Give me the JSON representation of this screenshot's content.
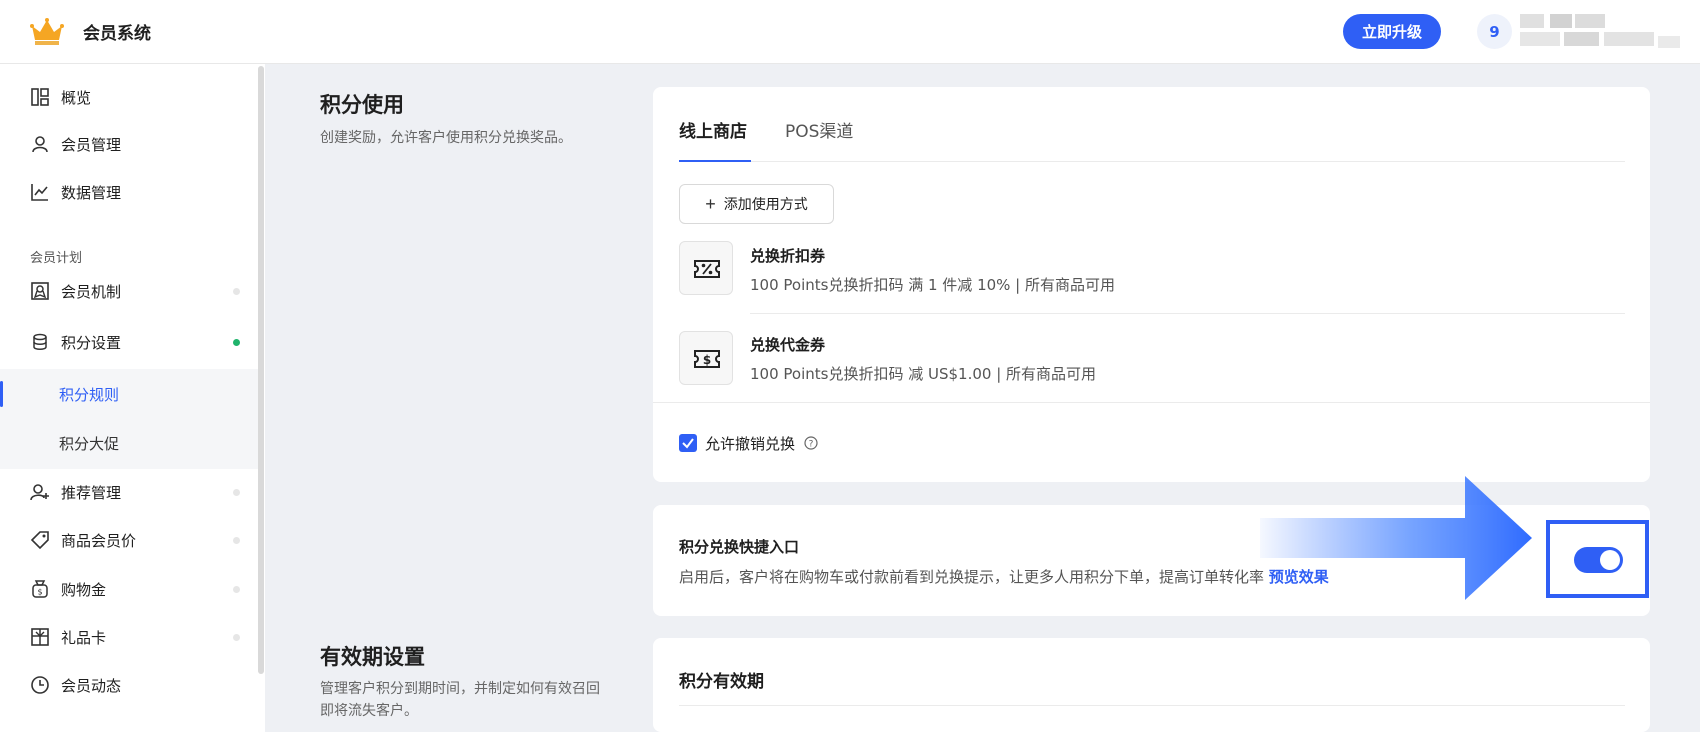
{
  "header": {
    "brand_title": "会员系统",
    "upgrade_label": "立即升级",
    "avatar_initial": "9"
  },
  "sidebar": {
    "items_top": [
      {
        "label": "概览",
        "icon": "dashboard-icon"
      },
      {
        "label": "会员管理",
        "icon": "user-icon"
      },
      {
        "label": "数据管理",
        "icon": "chart-icon"
      }
    ],
    "section_label": "会员计划",
    "items_plan": [
      {
        "label": "会员机制",
        "icon": "badge-icon"
      },
      {
        "label": "积分设置",
        "icon": "database-icon"
      }
    ],
    "sub_items": [
      {
        "label": "积分规则"
      },
      {
        "label": "积分大促"
      }
    ],
    "items_bottom": [
      {
        "label": "推荐管理",
        "icon": "user-add-icon"
      },
      {
        "label": "商品会员价",
        "icon": "tag-icon"
      },
      {
        "label": "购物金",
        "icon": "money-bag-icon"
      },
      {
        "label": "礼品卡",
        "icon": "gift-card-icon"
      },
      {
        "label": "会员动态",
        "icon": "clock-icon"
      }
    ],
    "active_dot_color": "#1fb36b"
  },
  "points_usage": {
    "title": "积分使用",
    "desc": "创建奖励，允许客户使用积分兑换奖品。",
    "tabs": [
      {
        "label": "线上商店"
      },
      {
        "label": "POS渠道"
      }
    ],
    "add_label": "添加使用方式",
    "coupons": [
      {
        "title": "兑换折扣券",
        "desc": "100 Points兑换折扣码 满 1 件减 10% | 所有商品可用",
        "icon": "percent-coupon-icon"
      },
      {
        "title": "兑换代金券",
        "desc": "100 Points兑换折扣码 减 US$1.00 | 所有商品可用",
        "icon": "dollar-coupon-icon"
      }
    ],
    "allow_revoke_label": "允许撤销兑换"
  },
  "quick_entry": {
    "title": "积分兑换快捷入口",
    "desc": "启用后，客户将在购物车或付款前看到兑换提示，让更多人用积分下单，提高订单转化率",
    "preview_link": "预览效果"
  },
  "expiry": {
    "title": "有效期设置",
    "desc_line1": "管理客户积分到期时间，并制定如何有效召回",
    "desc_line2": "即将流失客户。",
    "card_title": "积分有效期"
  },
  "accent_color": "#2f5ff5"
}
